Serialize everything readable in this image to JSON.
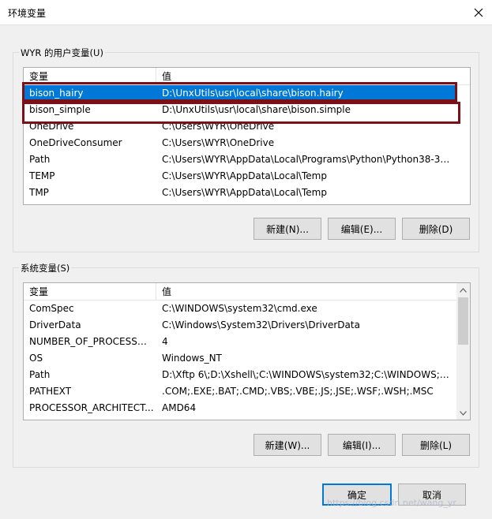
{
  "window": {
    "title": "环境变量",
    "close_icon": "close-icon"
  },
  "user_vars": {
    "group_label": "WYR 的用户变量(U)",
    "headers": {
      "name": "变量",
      "value": "值"
    },
    "rows": [
      {
        "name": "bison_hairy",
        "value": "D:\\UnxUtils\\usr\\local\\share\\bison.hairy",
        "selected": true
      },
      {
        "name": "bison_simple",
        "value": "D:\\UnxUtils\\usr\\local\\share\\bison.simple",
        "selected": false
      },
      {
        "name": "OneDrive",
        "value": "C:\\Users\\WYR\\OneDrive",
        "selected": false
      },
      {
        "name": "OneDriveConsumer",
        "value": "C:\\Users\\WYR\\OneDrive",
        "selected": false
      },
      {
        "name": "Path",
        "value": "C:\\Users\\WYR\\AppData\\Local\\Programs\\Python\\Python38-32...",
        "selected": false
      },
      {
        "name": "TEMP",
        "value": "C:\\Users\\WYR\\AppData\\Local\\Temp",
        "selected": false
      },
      {
        "name": "TMP",
        "value": "C:\\Users\\WYR\\AppData\\Local\\Temp",
        "selected": false
      }
    ],
    "buttons": {
      "new": "新建(N)...",
      "edit": "编辑(E)...",
      "delete": "删除(D)"
    }
  },
  "system_vars": {
    "group_label": "系统变量(S)",
    "headers": {
      "name": "变量",
      "value": "值"
    },
    "rows": [
      {
        "name": "ComSpec",
        "value": "C:\\WINDOWS\\system32\\cmd.exe"
      },
      {
        "name": "DriverData",
        "value": "C:\\Windows\\System32\\Drivers\\DriverData"
      },
      {
        "name": "NUMBER_OF_PROCESSORS",
        "value": "4"
      },
      {
        "name": "OS",
        "value": "Windows_NT"
      },
      {
        "name": "Path",
        "value": "D:\\Xftp 6\\;D:\\Xshell\\;C:\\WINDOWS\\system32;C:\\WINDOWS;C:..."
      },
      {
        "name": "PATHEXT",
        "value": ".COM;.EXE;.BAT;.CMD;.VBS;.VBE;.JS;.JSE;.WSF;.WSH;.MSC"
      },
      {
        "name": "PROCESSOR_ARCHITECT...",
        "value": "AMD64"
      }
    ],
    "buttons": {
      "new": "新建(W)...",
      "edit": "编辑(I)...",
      "delete": "删除(L)"
    }
  },
  "footer": {
    "ok": "确定",
    "cancel": "取消"
  },
  "watermark": "https://blog.csdn.net/wang_yr",
  "colors": {
    "selection": "#0078d7",
    "highlight_box": "#7b1117",
    "button_face": "#e1e1e1"
  }
}
